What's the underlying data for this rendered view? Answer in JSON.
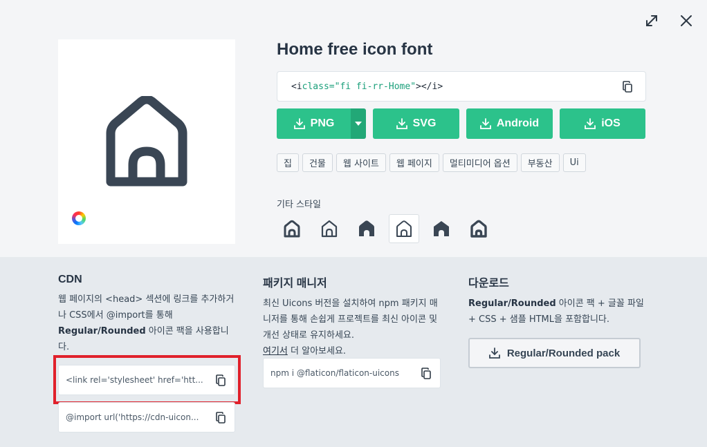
{
  "header": {
    "expand_icon": "expand-icon",
    "close_icon": "close-icon"
  },
  "icon": {
    "title": "Home free icon font",
    "code": {
      "open_bracket": "<i ",
      "attr": "class=\"fi fi-rr-Home\"",
      "close_tag": "></i>"
    }
  },
  "downloads": {
    "png": "PNG",
    "svg": "SVG",
    "android": "Android",
    "ios": "iOS"
  },
  "tags": [
    "집",
    "건물",
    "웹 사이트",
    "웹 페이지",
    "멀티미디어 옵션",
    "부동산",
    "Ui"
  ],
  "other_styles": {
    "label": "기타 스타일",
    "items": [
      "home-regular-rounded",
      "home-regular-straight",
      "home-solid-rounded",
      "home-regular-selected",
      "home-solid-straight",
      "home-bold-rounded"
    ]
  },
  "cdn": {
    "title": "CDN",
    "desc_1": "웹 페이지의 <head> 섹션에 링크를 추가하거나 CSS에서 @import를 통해 ",
    "desc_bold": "Regular/Rounded",
    "desc_2": " 아이콘 팩을 사용합니다.",
    "link_snippet": "<link rel='stylesheet' href='htt...",
    "import_snippet": "@import url('https://cdn-uicon..."
  },
  "package": {
    "title": "패키지 매니저",
    "desc": "최신 Uicons 버전을 설치하여 npm 패키지 매니저를 통해 손쉽게 프로젝트를 최신 아이콘 및 개선 상태로 유지하세요.",
    "link_text": "여기서",
    "link_suffix": " 더 알아보세요.",
    "npm_snippet": "npm i @flaticon/flaticon-uicons"
  },
  "download": {
    "title": "다운로드",
    "desc_bold": "Regular/Rounded",
    "desc": " 아이콘 팩 + 글꼴 파일 + CSS + 샘플 HTML을 포함합니다.",
    "pack_button": "Regular/Rounded pack"
  },
  "colors": {
    "accent": "#2cc28b",
    "accent_dark": "#22a877",
    "icon": "#3a4654",
    "highlight": "#e0212b"
  }
}
